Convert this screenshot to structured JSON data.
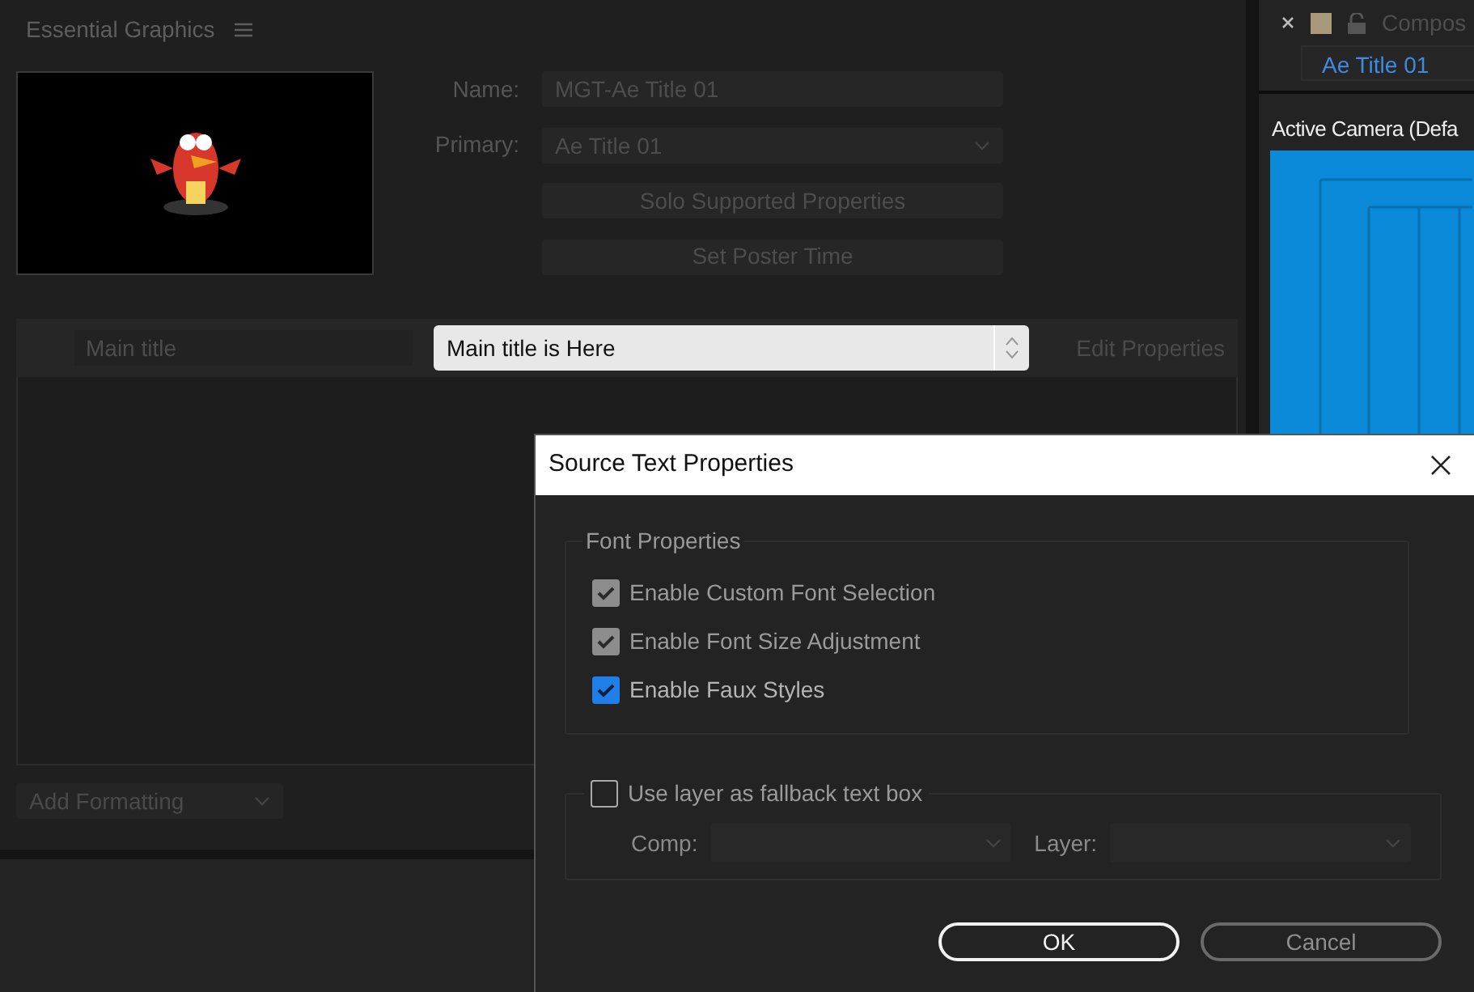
{
  "panel": {
    "title": "Essential Graphics"
  },
  "template": {
    "name_label": "Name:",
    "name_value": "MGT-Ae Title 01",
    "primary_label": "Primary:",
    "primary_value": "Ae Title 01",
    "buttons": [
      "Solo Supported Properties",
      "Set Poster Time"
    ]
  },
  "property": {
    "name": "Main title",
    "value": "Main title is Here",
    "edit": "Edit Properties"
  },
  "add_formatting": "Add Formatting",
  "composition_panel": {
    "title": "Compos",
    "tab": "Ae Title 01",
    "camera": "Active Camera (Defa"
  },
  "dialog": {
    "title": "Source Text Properties",
    "group": "Font Properties",
    "options": [
      {
        "label": "Enable Custom Font Selection",
        "checked": true,
        "disabled": true
      },
      {
        "label": "Enable Font Size Adjustment",
        "checked": true,
        "disabled": true
      },
      {
        "label": "Enable Faux Styles",
        "checked": true,
        "disabled": false
      }
    ],
    "fallback": {
      "label": "Use layer as fallback text box",
      "checked": false
    },
    "comp_label": "Comp:",
    "layer_label": "Layer:",
    "buttons": [
      {
        "label": "OK",
        "default": true
      },
      {
        "label": "Cancel",
        "default": false
      }
    ]
  }
}
